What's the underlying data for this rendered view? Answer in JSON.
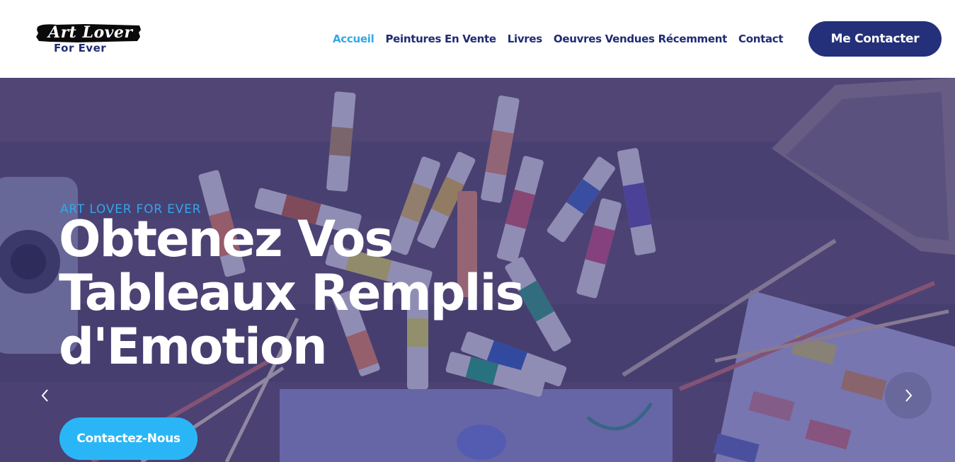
{
  "logo": {
    "script_text": "Art Lover",
    "sub_text": "For Ever"
  },
  "nav": {
    "items": [
      {
        "label": "Accueil",
        "active": true
      },
      {
        "label": "Peintures En Vente",
        "active": false
      },
      {
        "label": "Livres",
        "active": false
      },
      {
        "label": "Oeuvres Vendues Récemment",
        "active": false
      },
      {
        "label": "Contact",
        "active": false
      }
    ]
  },
  "header": {
    "cta_label": "Me Contacter"
  },
  "hero": {
    "eyebrow": "ART LOVER FOR EVER",
    "headline_lines": [
      "Obtenez Vos",
      "Tableaux Remplis",
      "d'Emotion"
    ],
    "cta_label": "Contactez-Nous",
    "prev_icon": "chevron-left-icon",
    "next_icon": "chevron-right-icon"
  },
  "colors": {
    "brand_dark": "#1e2c74",
    "brand_light": "#30a9e6",
    "cta_header_bg": "#24307a",
    "cta_hero_bg": "#2ab6f6",
    "hero_overlay": "#3a3882"
  }
}
